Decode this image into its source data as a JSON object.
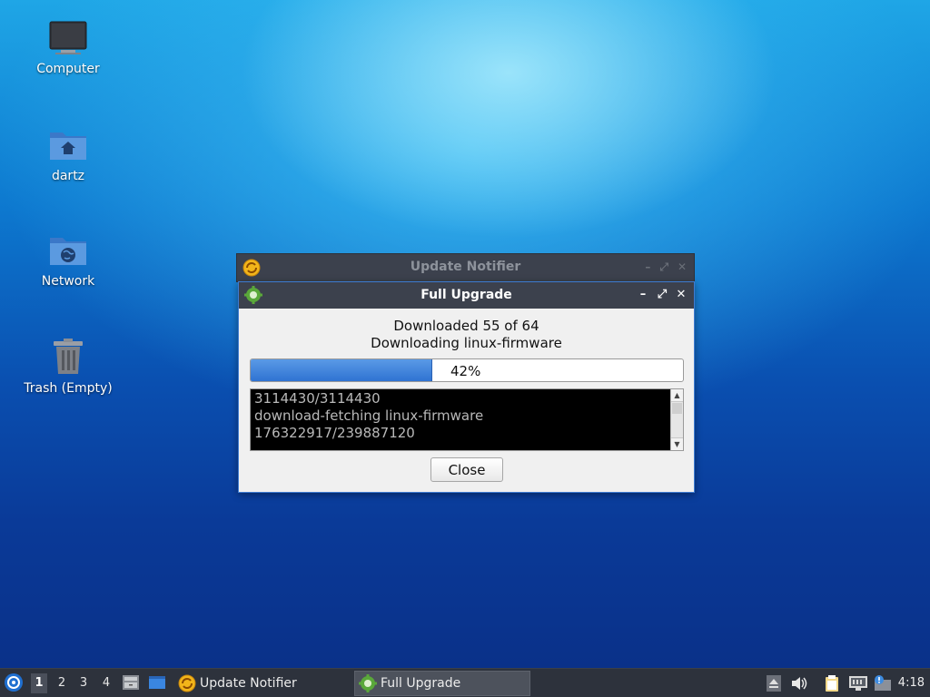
{
  "desktop": {
    "icons": [
      {
        "label": "Computer"
      },
      {
        "label": "dartz"
      },
      {
        "label": "Network"
      },
      {
        "label": "Trash (Empty)"
      }
    ]
  },
  "background_window": {
    "title": "Update Notifier",
    "minimize": "–",
    "maximize": "⤢",
    "close": "✕"
  },
  "dialog": {
    "title": "Full Upgrade",
    "minimize": "–",
    "maximize": "⤢",
    "close": "✕",
    "status_line1": "Downloaded 55 of 64",
    "status_line2": "Downloading linux-firmware",
    "progress_percent": 42,
    "progress_text": "42%",
    "log_lines": [
      "3114430/3114430",
      "download-fetching linux-firmware",
      "176322917/239887120"
    ],
    "close_button": "Close"
  },
  "taskbar": {
    "workspaces": [
      "1",
      "2",
      "3",
      "4"
    ],
    "active_workspace": "1",
    "tasks": [
      {
        "label": "Update Notifier",
        "active": false
      },
      {
        "label": "Full Upgrade",
        "active": true
      }
    ],
    "clock": "4:18"
  },
  "colors": {
    "accent": "#3d7bd1",
    "titlebar": "#3c414d",
    "taskbar": "#2d323c",
    "progress_fill": "#3a7fd9"
  }
}
